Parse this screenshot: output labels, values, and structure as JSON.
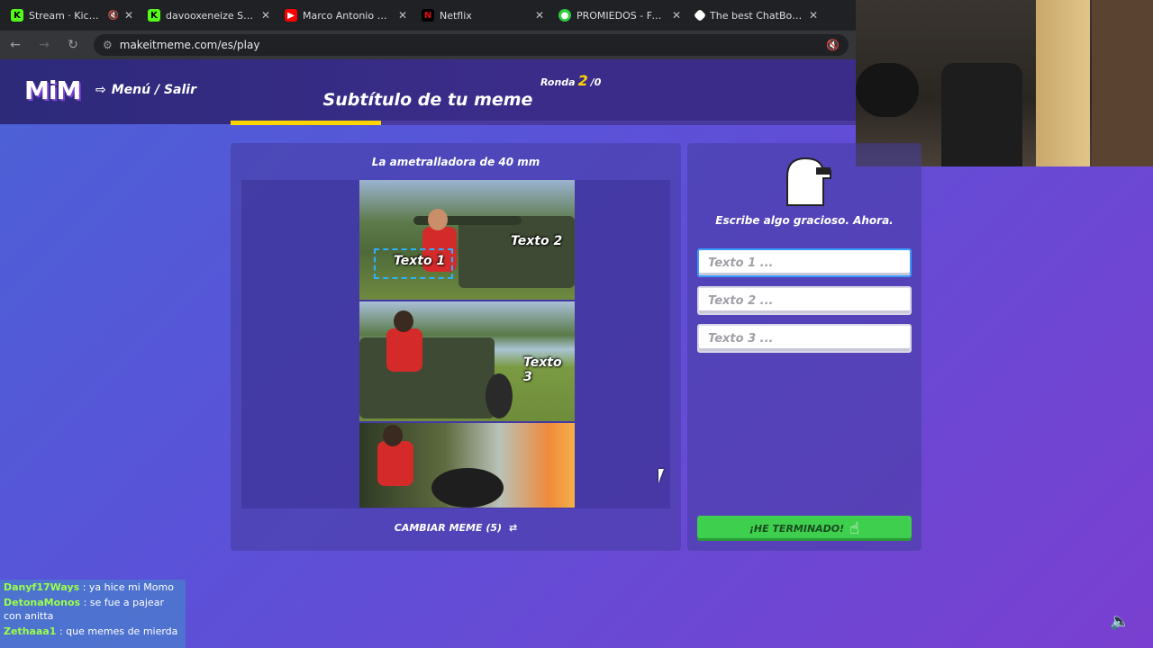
{
  "browser": {
    "tabs": [
      {
        "label": "Stream · Kick Dash",
        "icon": "kick-icon",
        "color": "#53fc18",
        "muted": true
      },
      {
        "label": "davooxeneize Stream",
        "icon": "kick-icon",
        "color": "#53fc18",
        "muted": false
      },
      {
        "label": "Marco Antonio Solís -",
        "icon": "youtube-icon",
        "color": "#ff0000",
        "muted": false
      },
      {
        "label": "Netflix",
        "icon": "netflix-icon",
        "color": "#e50914",
        "muted": false
      },
      {
        "label": "PROMIEDOS - Futbol A",
        "icon": "promiedos-icon",
        "color": "#2ecc40",
        "muted": false
      },
      {
        "label": "The best ChatBot and",
        "icon": "chatbot-icon",
        "color": "#ffffff",
        "muted": false
      }
    ],
    "url": "makeitmeme.com/es/play"
  },
  "header": {
    "logo": "MiM",
    "menu_label": "Menú / Salir",
    "round_label": "Ronda",
    "round_num": "2",
    "round_total": "/0",
    "subtitle": "Subtítulo de tu meme",
    "progress": 0.24
  },
  "meme": {
    "title": "La ametralladora de 40 mm",
    "captions": [
      "Texto 1",
      "Texto 2",
      "Texto 3"
    ],
    "change_label": "CAMBIAR MEME (5)"
  },
  "editor": {
    "prompt": "Escribe algo gracioso. Ahora.",
    "inputs": [
      {
        "placeholder": "Texto 1 ...",
        "value": ""
      },
      {
        "placeholder": "Texto 2 ...",
        "value": ""
      },
      {
        "placeholder": "Texto 3 ...",
        "value": ""
      }
    ],
    "done_label": "¡HE TERMINADO!"
  },
  "chat": [
    {
      "user": "Danyf17Ways",
      "message": ": ya hice mi Momo",
      "color": "#9bff4a"
    },
    {
      "user": "DetonaMonos",
      "message": ": se fue a pajear con anitta",
      "color": "#9bff4a"
    },
    {
      "user": "Zethaaa1",
      "message": ": que memes de mierda",
      "color": "#9bff4a"
    }
  ],
  "colors": {
    "accent_yellow": "#ffd400",
    "done_green": "#3fcf4e",
    "input_focus": "#3a9bff"
  }
}
